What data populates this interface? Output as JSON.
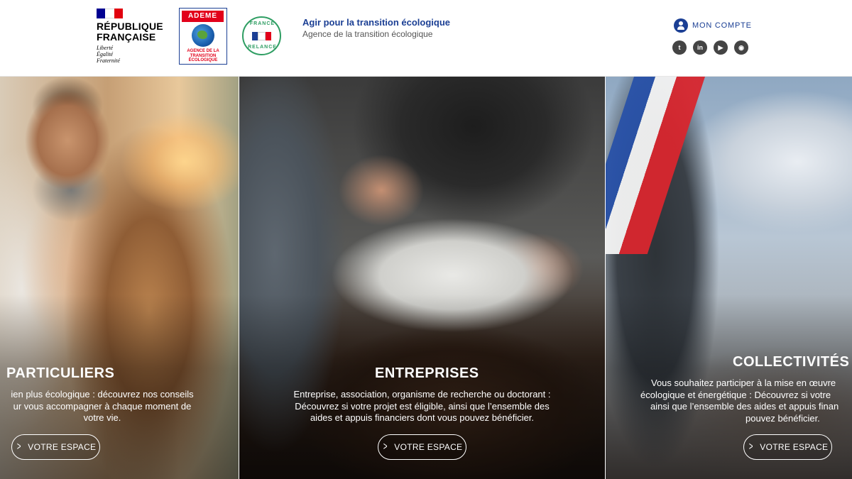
{
  "header": {
    "republique": {
      "name_line1": "RÉPUBLIQUE",
      "name_line2": "FRANÇAISE",
      "motto_line1": "Liberté",
      "motto_line2": "Égalité",
      "motto_line3": "Fraternité",
      "flag_colors": [
        "#000091",
        "#ffffff",
        "#e1000f"
      ]
    },
    "ademe_logo": {
      "top_text": "ADEME",
      "line1": "AGENCE DE LA",
      "line2": "TRANSITION",
      "line3": "ÉCOLOGIQUE",
      "icon": "globe-icon"
    },
    "france_relance_logo": {
      "line1": "FRANCE",
      "line2": "RELANCE"
    },
    "tagline": {
      "title": "Agir pour la transition écologique",
      "subtitle": "Agence de la transition écologique"
    },
    "account": {
      "label": "MON COMPTE",
      "icon": "user-icon"
    },
    "social": [
      {
        "name": "twitter-icon",
        "glyph": "t"
      },
      {
        "name": "linkedin-icon",
        "glyph": "in"
      },
      {
        "name": "youtube-icon",
        "glyph": "▶"
      },
      {
        "name": "rss-icon",
        "glyph": "◉"
      }
    ]
  },
  "panels": [
    {
      "title": "PARTICULIERS",
      "desc_line1": "ien plus écologique : découvrez nos conseils",
      "desc_line2": "ur vous accompagner à chaque moment de",
      "desc_line3": "votre vie.",
      "button": "VOTRE ESPACE"
    },
    {
      "title": "ENTREPRISES",
      "desc_line1": "Entreprise, association, organisme de recherche ou doctorant :",
      "desc_line2": "Découvrez si votre projet est éligible, ainsi que l’ensemble des",
      "desc_line3": "aides et appuis financiers dont vous pouvez bénéficier.",
      "button": "VOTRE ESPACE"
    },
    {
      "title": "COLLECTIVITÉS",
      "desc_line1": "Vous souhaitez participer à la mise en œuvre",
      "desc_line2": "écologique et énergétique : Découvrez si votre",
      "desc_line3": "ainsi que l’ensemble des aides et appuis finan",
      "desc_line4": "pouvez bénéficier.",
      "button": "VOTRE ESPACE"
    }
  ],
  "colors": {
    "brand_blue": "#1b3f94",
    "ademe_red": "#e2001a",
    "relance_green": "#2f9e63"
  }
}
